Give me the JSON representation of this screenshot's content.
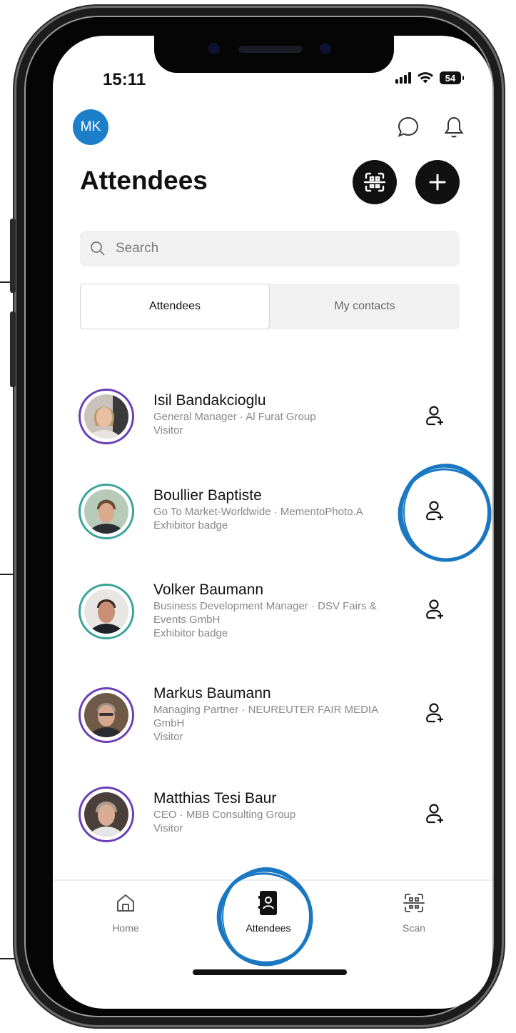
{
  "status": {
    "time": "15:11",
    "battery": "54"
  },
  "header": {
    "avatar_initials": "MK",
    "title": "Attendees"
  },
  "search": {
    "placeholder": "Search"
  },
  "tabs": [
    {
      "label": "Attendees",
      "active": true
    },
    {
      "label": "My contacts",
      "active": false
    }
  ],
  "attendees": [
    {
      "name": "Isil Bandakcioglu",
      "subtitle": "General Manager · Al Furat Group",
      "badge": "Visitor",
      "ring_color": "#6b3fb5"
    },
    {
      "name": "Boullier Baptiste",
      "subtitle": "Go To Market-Worldwide · MementoPhoto.A",
      "badge": "Exhibitor badge",
      "ring_color": "#3aa39a"
    },
    {
      "name": "Volker Baumann",
      "subtitle": "Business Development Manager · DSV Fairs & Events GmbH",
      "badge": "Exhibitor badge",
      "ring_color": "#3aa39a"
    },
    {
      "name": "Markus Baumann",
      "subtitle": "Managing Partner · NEUREUTER FAIR MEDIA GmbH",
      "badge": "Visitor",
      "ring_color": "#6b3fb5"
    },
    {
      "name": "Matthias Tesi Baur",
      "subtitle": "CEO · MBB Consulting Group",
      "badge": "Visitor",
      "ring_color": "#6b3fb5"
    }
  ],
  "bottom_nav": [
    {
      "label": "Home",
      "icon": "home-icon",
      "active": false
    },
    {
      "label": "Attendees",
      "icon": "contacts-book-icon",
      "active": true
    },
    {
      "label": "Scan",
      "icon": "qr-scan-icon",
      "active": false
    }
  ],
  "colors": {
    "accent_blue": "#1d7fc9",
    "annotation_circle": "#1a78c2"
  }
}
